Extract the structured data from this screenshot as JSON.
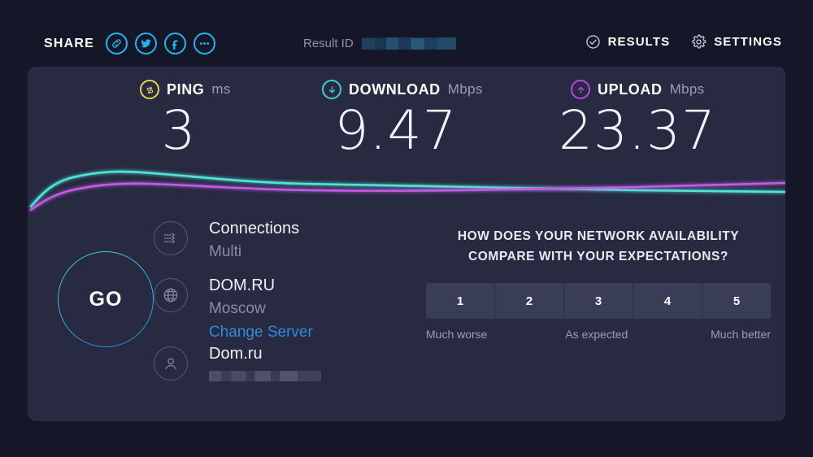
{
  "topbar": {
    "share_label": "SHARE",
    "share_icons": [
      {
        "name": "link-icon"
      },
      {
        "name": "twitter-icon"
      },
      {
        "name": "facebook-icon"
      },
      {
        "name": "more-icon"
      }
    ],
    "result_id_label": "Result ID",
    "result_id_value": "",
    "results_label": "RESULTS",
    "settings_label": "SETTINGS"
  },
  "metrics": [
    {
      "id": "ping",
      "name": "PING",
      "unit": "ms",
      "value": "3",
      "icon": "ping-icon",
      "color": "#e3d54e"
    },
    {
      "id": "download",
      "name": "DOWNLOAD",
      "unit": "Mbps",
      "value": "9.47",
      "icon": "download-arrow-icon",
      "color": "#38d4c8"
    },
    {
      "id": "upload",
      "name": "UPLOAD",
      "unit": "Mbps",
      "value": "23.37",
      "icon": "upload-arrow-icon",
      "color": "#b44ae0"
    }
  ],
  "graph": {
    "download_color": "#4fe6da",
    "upload_color": "#c45ae8"
  },
  "go_button": {
    "label": "GO"
  },
  "info": {
    "connections": {
      "title": "Connections",
      "subtitle": "Multi",
      "icon": "connections-icon"
    },
    "server": {
      "title": "DOM.RU",
      "subtitle": "Moscow",
      "link": "Change Server",
      "icon": "globe-icon"
    },
    "client": {
      "title": "Dom.ru",
      "ip": "",
      "icon": "person-icon"
    }
  },
  "survey": {
    "question_line1": "HOW DOES YOUR NETWORK AVAILABILITY",
    "question_line2": "COMPARE WITH YOUR EXPECTATIONS?",
    "options": [
      "1",
      "2",
      "3",
      "4",
      "5"
    ],
    "label_low": "Much worse",
    "label_mid": "As expected",
    "label_high": "Much better"
  },
  "colors": {
    "page_background": "#151729",
    "panel_background": "#272a41",
    "accent_blue": "#1fb6f0",
    "link_blue": "#2b8ede"
  }
}
